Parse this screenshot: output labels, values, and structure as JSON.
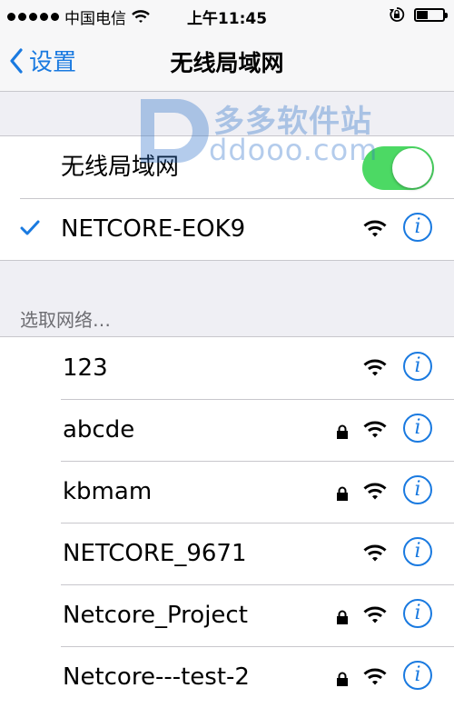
{
  "status_bar": {
    "carrier": "中国电信",
    "time": "上午11:45",
    "icons": [
      "signal-dots",
      "wifi-icon",
      "rotation-lock-icon",
      "battery-icon"
    ]
  },
  "nav": {
    "back_label": "设置",
    "title": "无线局域网"
  },
  "watermark": {
    "cn": "多多软件站",
    "en": "ddooo.com"
  },
  "wifi_toggle": {
    "label": "无线局域网",
    "on": true
  },
  "connected": {
    "ssid": "NETCORE-EOK9",
    "secured": false
  },
  "section_header": "选取网络…",
  "networks": [
    {
      "ssid": "123",
      "secured": false
    },
    {
      "ssid": "abcde",
      "secured": true
    },
    {
      "ssid": "kbmam",
      "secured": true
    },
    {
      "ssid": "NETCORE_9671",
      "secured": false
    },
    {
      "ssid": "Netcore_Project",
      "secured": true
    },
    {
      "ssid": "Netcore---test-2",
      "secured": true
    }
  ],
  "colors": {
    "accent": "#1a7ae0",
    "toggle_on": "#4cd964",
    "background": "#efeff4"
  }
}
